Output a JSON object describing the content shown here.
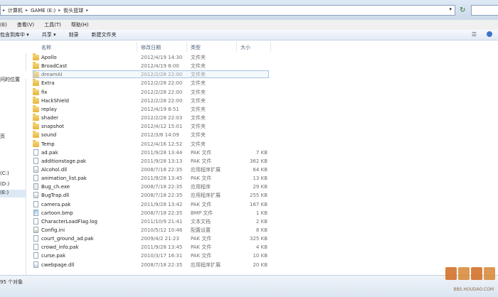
{
  "address_bar": {
    "path": [
      "计算机",
      "GAME (E:)",
      "街头篮球"
    ],
    "dropdown_glyph": "▾"
  },
  "menu": [
    "(E)",
    "查看(V)",
    "工具(T)",
    "帮助(H)"
  ],
  "toolbar": {
    "include": "包含到库中 ▾",
    "share": "共享 ▾",
    "burn": "刻录",
    "new_folder": "新建文件夹"
  },
  "nav": {
    "items": [
      {
        "label": "问的位置",
        "selected": false
      },
      {
        "label": "页",
        "selected": false
      },
      {
        "label": "(C:)",
        "selected": false
      },
      {
        "label": "(D:)",
        "selected": false
      },
      {
        "label": "(E:)",
        "selected": true
      }
    ]
  },
  "columns": {
    "name": "名称",
    "date": "修改日期",
    "type": "类型",
    "size": "大小"
  },
  "files": [
    {
      "name": "Apollo",
      "date": "2012/4/19 14:30",
      "type": "文件夹",
      "size": "",
      "kind": "folder"
    },
    {
      "name": "BroadCast",
      "date": "2012/4/19 8:00",
      "type": "文件夹",
      "size": "",
      "kind": "folder"
    },
    {
      "name": "dreamAI",
      "date": "2012/2/28 22:00",
      "type": "文件夹",
      "size": "",
      "kind": "folder",
      "selected": true
    },
    {
      "name": "Extra",
      "date": "2012/2/28 22:00",
      "type": "文件夹",
      "size": "",
      "kind": "folder"
    },
    {
      "name": "fix",
      "date": "2012/2/28 22:00",
      "type": "文件夹",
      "size": "",
      "kind": "folder"
    },
    {
      "name": "HackShield",
      "date": "2012/2/28 22:00",
      "type": "文件夹",
      "size": "",
      "kind": "folder"
    },
    {
      "name": "replay",
      "date": "2012/4/19 8:51",
      "type": "文件夹",
      "size": "",
      "kind": "folder"
    },
    {
      "name": "shader",
      "date": "2012/2/28 22:03",
      "type": "文件夹",
      "size": "",
      "kind": "folder"
    },
    {
      "name": "snapshot",
      "date": "2012/4/12 15:01",
      "type": "文件夹",
      "size": "",
      "kind": "folder"
    },
    {
      "name": "sound",
      "date": "2012/3/6 14:09",
      "type": "文件夹",
      "size": "",
      "kind": "folder"
    },
    {
      "name": "Temp",
      "date": "2012/4/16 12:52",
      "type": "文件夹",
      "size": "",
      "kind": "folder"
    },
    {
      "name": "ad.pak",
      "date": "2011/9/28 13:44",
      "type": "PAK 文件",
      "size": "7 KB",
      "kind": "file"
    },
    {
      "name": "additionstage.pak",
      "date": "2011/9/28 13:13",
      "type": "PAK 文件",
      "size": "362 KB",
      "kind": "file"
    },
    {
      "name": "Alcohol.dll",
      "date": "2008/7/18 22:35",
      "type": "应用程序扩展",
      "size": "64 KB",
      "kind": "dll"
    },
    {
      "name": "animation_list.pak",
      "date": "2011/9/28 13:45",
      "type": "PAK 文件",
      "size": "13 KB",
      "kind": "file"
    },
    {
      "name": "Bug_ch.exe",
      "date": "2008/7/18 22:35",
      "type": "应用程序",
      "size": "29 KB",
      "kind": "exe"
    },
    {
      "name": "BugTrap.dll",
      "date": "2008/7/18 22:35",
      "type": "应用程序扩展",
      "size": "255 KB",
      "kind": "dll"
    },
    {
      "name": "camera.pak",
      "date": "2011/9/28 13:42",
      "type": "PAK 文件",
      "size": "167 KB",
      "kind": "file"
    },
    {
      "name": "cartoon.bmp",
      "date": "2008/7/18 22:35",
      "type": "BMP 文件",
      "size": "1 KB",
      "kind": "bmp"
    },
    {
      "name": "CharacterLoadFlag.log",
      "date": "2011/10/9 21:41",
      "type": "文本文档",
      "size": "2 KB",
      "kind": "file"
    },
    {
      "name": "Config.ini",
      "date": "2010/5/12 10:46",
      "type": "配置设置",
      "size": "8 KB",
      "kind": "ini"
    },
    {
      "name": "court_ground_ad.pak",
      "date": "2009/4/2 21:23",
      "type": "PAK 文件",
      "size": "325 KB",
      "kind": "file"
    },
    {
      "name": "crowd_info.pak",
      "date": "2011/9/28 13:45",
      "type": "PAK 文件",
      "size": "4 KB",
      "kind": "file"
    },
    {
      "name": "curse.pak",
      "date": "2010/3/17 16:31",
      "type": "PAK 文件",
      "size": "10 KB",
      "kind": "file"
    },
    {
      "name": "cwebpage.dll",
      "date": "2008/7/18 22:35",
      "type": "应用程序扩展",
      "size": "20 KB",
      "kind": "dll"
    }
  ],
  "status": {
    "count_text": "95 个对象"
  },
  "watermark": {
    "logo": "猴岛论坛",
    "url": "BBS.HOUDAO.COM"
  }
}
